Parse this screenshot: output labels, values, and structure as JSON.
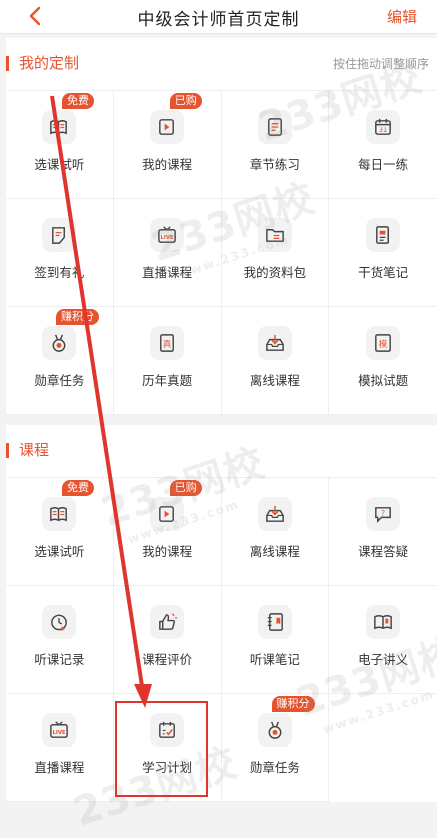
{
  "header": {
    "back_icon": "chevron-left-icon",
    "title": "中级会计师首页定制",
    "edit_label": "编辑"
  },
  "colors": {
    "accent": "#e5542f",
    "highlight": "#e0352d"
  },
  "my_custom": {
    "title": "我的定制",
    "hint": "按住拖动调整顺序",
    "items": [
      {
        "label": "选课试听",
        "icon": "open-book-icon",
        "badge": "免费"
      },
      {
        "label": "我的课程",
        "icon": "play-video-icon",
        "badge": "已购"
      },
      {
        "label": "章节练习",
        "icon": "document-list-icon",
        "badge": ""
      },
      {
        "label": "每日一练",
        "icon": "calendar-31-icon",
        "icon_text": "31",
        "badge": ""
      },
      {
        "label": "签到有礼",
        "icon": "sign-in-icon",
        "badge": ""
      },
      {
        "label": "直播课程",
        "icon": "live-tv-icon",
        "icon_text": "LIVE",
        "badge": ""
      },
      {
        "label": "我的资料包",
        "icon": "folder-icon",
        "badge": ""
      },
      {
        "label": "干货笔记",
        "icon": "notes-icon",
        "badge": ""
      },
      {
        "label": "勋章任务",
        "icon": "medal-icon",
        "badge": "赚积分"
      },
      {
        "label": "历年真题",
        "icon": "exam-paper-icon",
        "icon_text": "真",
        "badge": ""
      },
      {
        "label": "离线课程",
        "icon": "download-tray-icon",
        "badge": ""
      },
      {
        "label": "模拟试题",
        "icon": "mock-paper-icon",
        "icon_text": "模",
        "badge": ""
      }
    ]
  },
  "courses": {
    "title": "课程",
    "items": [
      {
        "label": "选课试听",
        "icon": "open-book-icon",
        "badge": "免费"
      },
      {
        "label": "我的课程",
        "icon": "play-video-icon",
        "badge": "已购"
      },
      {
        "label": "离线课程",
        "icon": "download-tray-icon",
        "badge": ""
      },
      {
        "label": "课程答疑",
        "icon": "question-chat-icon",
        "badge": ""
      },
      {
        "label": "听课记录",
        "icon": "clock-play-icon",
        "badge": ""
      },
      {
        "label": "课程评价",
        "icon": "thumbs-up-icon",
        "badge": ""
      },
      {
        "label": "听课笔记",
        "icon": "notebook-icon",
        "badge": ""
      },
      {
        "label": "电子讲义",
        "icon": "ebook-icon",
        "badge": ""
      },
      {
        "label": "直播课程",
        "icon": "live-tv-icon",
        "icon_text": "LIVE",
        "badge": ""
      },
      {
        "label": "学习计划",
        "icon": "plan-checklist-icon",
        "badge": ""
      },
      {
        "label": "勋章任务",
        "icon": "medal-icon",
        "badge": "赚积分"
      }
    ]
  },
  "watermark": {
    "text": "233网校",
    "subtext": "www.233.com"
  }
}
